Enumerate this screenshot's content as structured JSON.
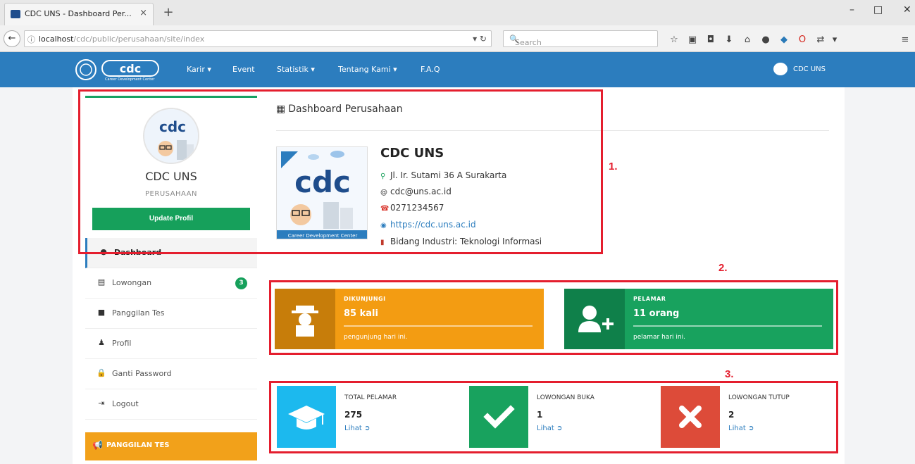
{
  "browser": {
    "tab_title": "CDC UNS - Dashboard Per...",
    "tab_close": "×",
    "new_tab": "+",
    "url_host": "localhost",
    "url_path": "/cdc/public/perusahaan/site/index",
    "search_placeholder": "Search",
    "window_controls": {
      "minimize": "–",
      "maximize": "□",
      "close": "✕"
    }
  },
  "navbar": {
    "logo_text": "cdc",
    "logo_subtext": "Career Development Center",
    "items": [
      {
        "label": "Karir ▾"
      },
      {
        "label": "Event"
      },
      {
        "label": "Statistik ▾"
      },
      {
        "label": "Tentang Kami ▾"
      },
      {
        "label": "F.A.Q"
      }
    ],
    "user_name": "CDC UNS"
  },
  "sidebar": {
    "profile_name": "CDC UNS",
    "profile_role": "PERUSAHAAN",
    "update_button": "Update Profil",
    "menu": [
      {
        "label": "Dashboard",
        "icon": "dashboard-icon",
        "glyph": "●",
        "active": true
      },
      {
        "label": "Lowongan",
        "icon": "document-icon",
        "glyph": "▤",
        "badge": "3"
      },
      {
        "label": "Panggilan Tes",
        "icon": "folder-icon",
        "glyph": "■"
      },
      {
        "label": "Profil",
        "icon": "user-icon",
        "glyph": "♟"
      },
      {
        "label": "Ganti Password",
        "icon": "lock-icon",
        "glyph": "🔒"
      },
      {
        "label": "Logout",
        "icon": "logout-icon",
        "glyph": "⇥"
      }
    ],
    "panggilan_title": "PANGGILAN TES"
  },
  "dashboard": {
    "title": "Dashboard Perusahaan",
    "company": {
      "name": "CDC UNS",
      "address": "Jl. Ir. Sutami 36 A Surakarta",
      "email": "cdc@uns.ac.id",
      "phone": "0271234567",
      "website": "https://cdc.uns.ac.id",
      "industry": "Bidang Industri: Teknologi Informasi"
    },
    "stats": [
      {
        "label": "DIKUNJUNGI",
        "value": "85 kali",
        "desc": "pengunjung hari ini.",
        "color": "#f39c12",
        "icon_color": "#c77d0a"
      },
      {
        "label": "PELAMAR",
        "value": "11 orang",
        "desc": "pelamar hari ini.",
        "color": "#18a25e",
        "icon_color": "#0f804a"
      }
    ],
    "info_boxes": [
      {
        "label": "TOTAL PELAMAR",
        "value": "275",
        "link": "Lihat",
        "color": "#1cb9ee"
      },
      {
        "label": "LOWONGAN BUKA",
        "value": "1",
        "link": "Lihat",
        "color": "#18a25e"
      },
      {
        "label": "LOWONGAN TUTUP",
        "value": "2",
        "link": "Lihat",
        "color": "#dd4b39"
      }
    ]
  },
  "annotations": [
    "1.",
    "2.",
    "3."
  ],
  "colors": {
    "primary": "#2c7dbe",
    "success": "#16a05b",
    "annotation": "#e41e2e"
  }
}
